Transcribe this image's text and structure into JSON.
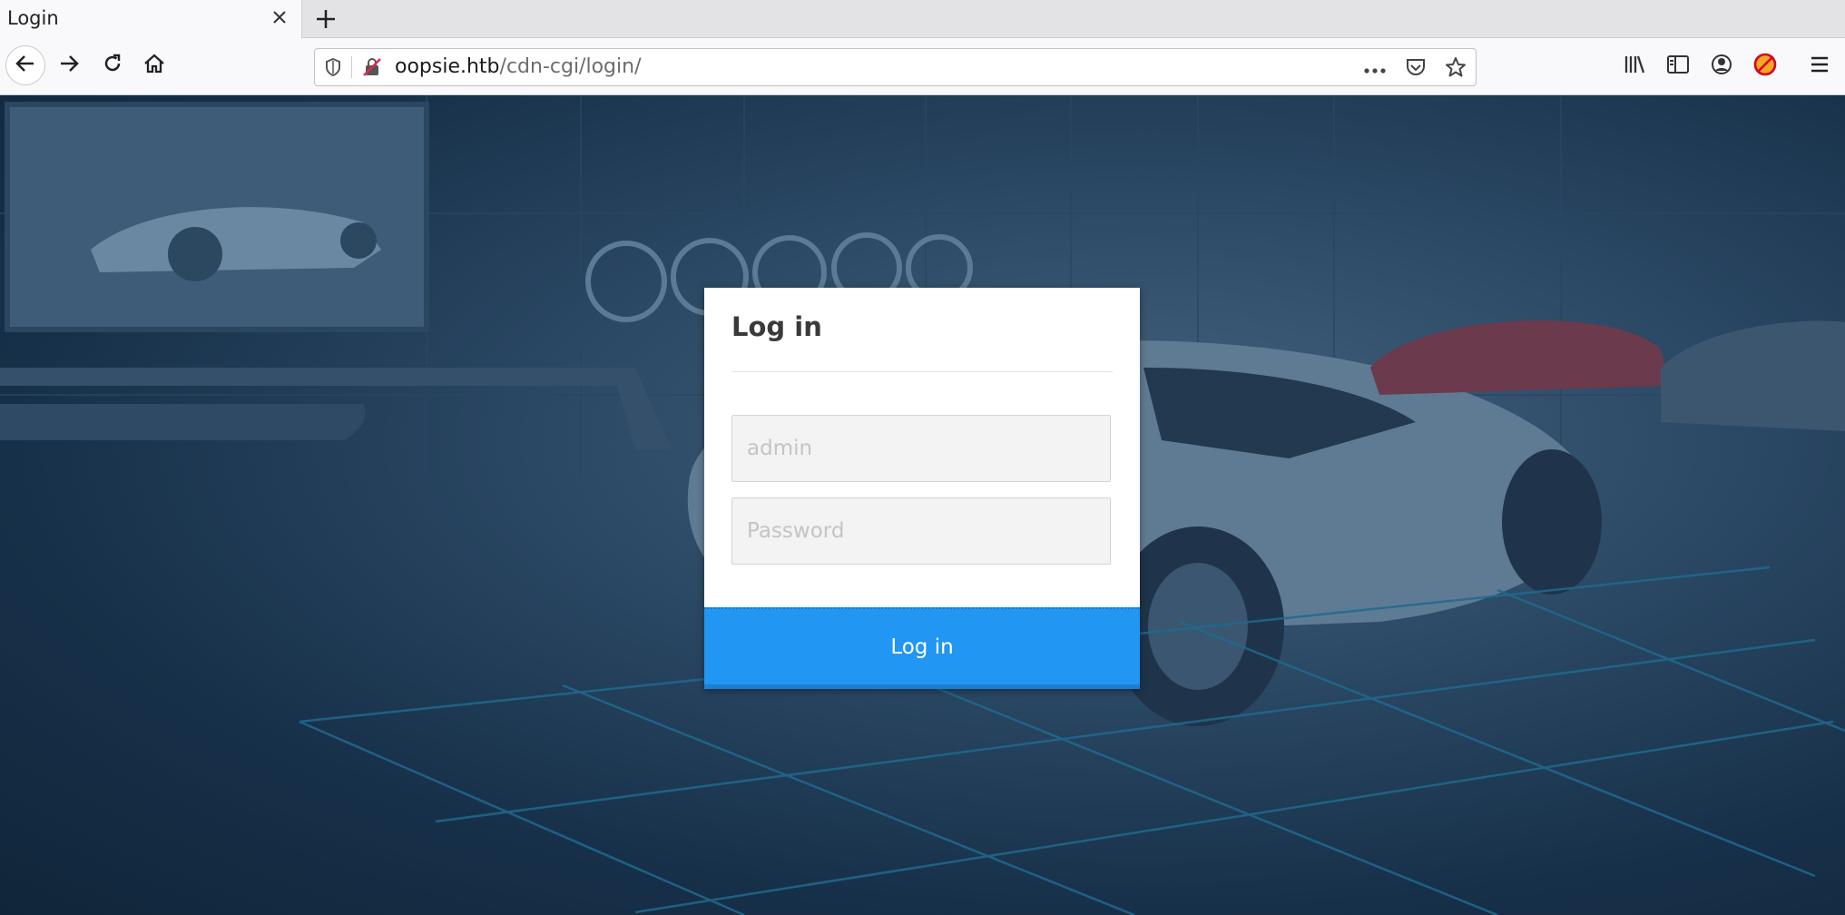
{
  "tab": {
    "title": "Login"
  },
  "url": {
    "host": "oopsie.htb",
    "path": "/cdn-cgi/login/"
  },
  "login": {
    "heading": "Log in",
    "username_placeholder": "admin",
    "password_placeholder": "Password",
    "submit_label": "Log in"
  },
  "colors": {
    "accent": "#2196f3",
    "overlay": "#173049"
  },
  "icons": [
    "close-icon",
    "plus-icon",
    "back-arrow-icon",
    "forward-arrow-icon",
    "reload-icon",
    "home-icon",
    "shield-icon",
    "insecure-lock-icon",
    "more-icon",
    "pocket-icon",
    "star-icon",
    "library-icon",
    "sidebar-icon",
    "account-icon",
    "blocked-addon-icon",
    "menu-icon"
  ]
}
